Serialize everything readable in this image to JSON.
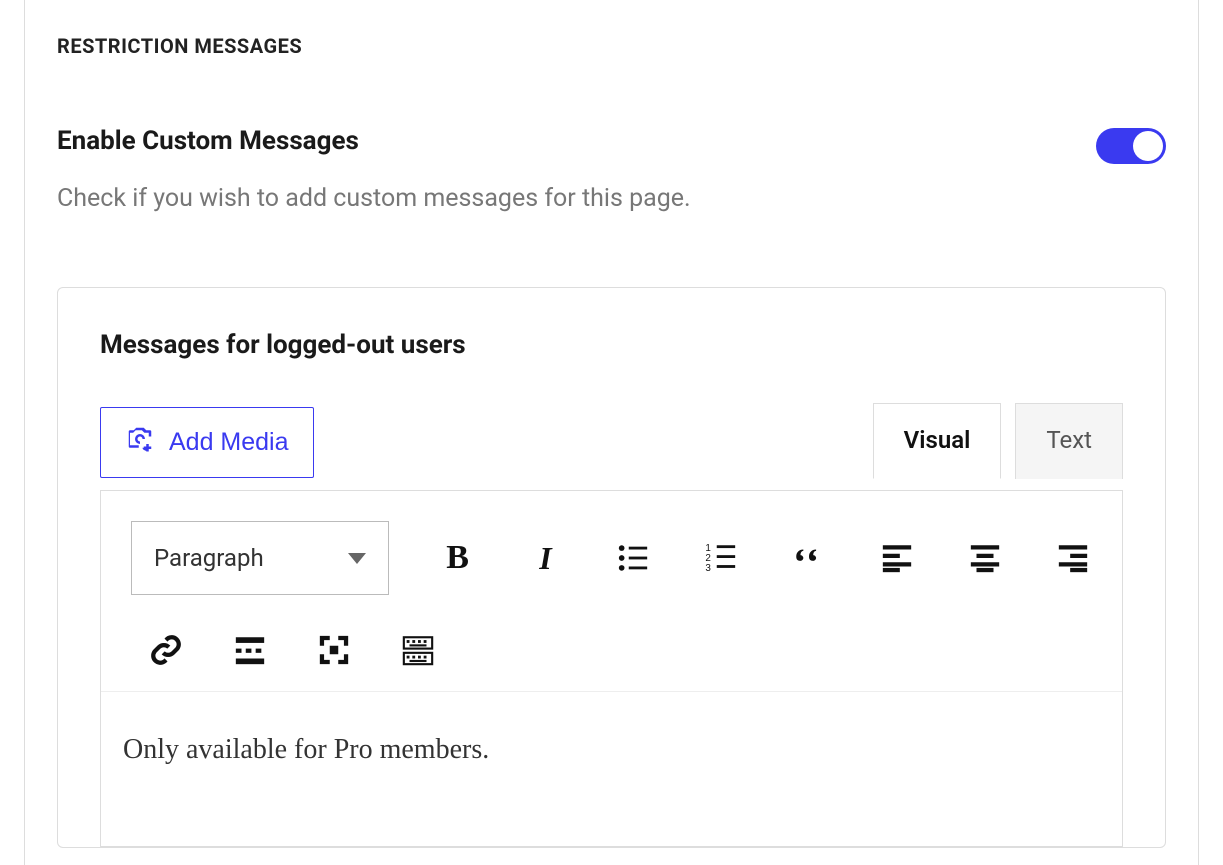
{
  "section": {
    "title": "RESTRICTION MESSAGES"
  },
  "toggle": {
    "label": "Enable Custom Messages",
    "description": "Check if you wish to add custom messages for this page.",
    "enabled": true
  },
  "panel": {
    "heading": "Messages for logged-out users"
  },
  "media": {
    "add_label": "Add Media"
  },
  "tabs": {
    "visual": "Visual",
    "text": "Text",
    "active": "visual"
  },
  "format_select": {
    "value": "Paragraph"
  },
  "toolbar_icons": {
    "bold": "bold",
    "italic": "italic",
    "ul": "bulleted-list",
    "ol": "numbered-list",
    "quote": "blockquote",
    "align_left": "align-left",
    "align_center": "align-center",
    "align_right": "align-right",
    "link": "link",
    "readmore": "read-more",
    "fullscreen": "fullscreen",
    "kitchen_sink": "toolbar-toggle"
  },
  "content": {
    "body": "Only available for Pro members."
  }
}
